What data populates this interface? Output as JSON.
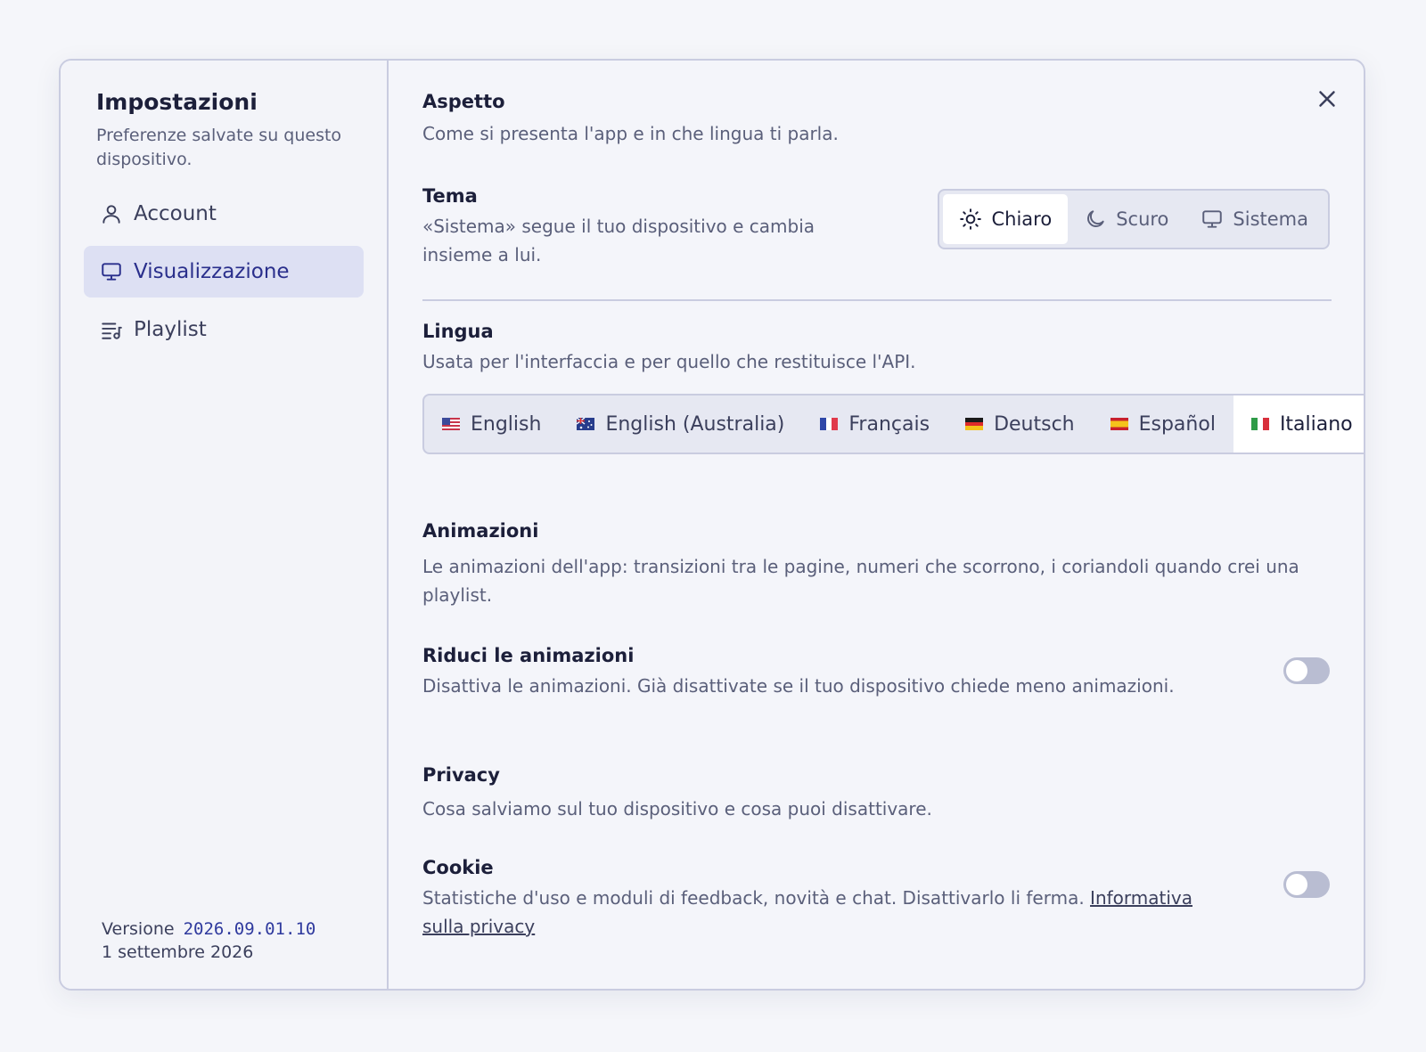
{
  "sidebar": {
    "title": "Impostazioni",
    "subtitle": "Preferenze salvate su questo dispositivo.",
    "items": [
      {
        "label": "Account",
        "icon": "user-icon"
      },
      {
        "label": "Visualizzazione",
        "icon": "monitor-icon",
        "active": true
      },
      {
        "label": "Playlist",
        "icon": "playlist-icon"
      }
    ],
    "version_label": "Versione",
    "version_code": "2026.09.01.10",
    "version_date": "1 settembre 2026"
  },
  "appearance": {
    "title": "Aspetto",
    "description": "Come si presenta l'app e in che lingua ti parla."
  },
  "theme": {
    "title": "Tema",
    "description": "«Sistema» segue il tuo dispositivo e cambia insieme a lui.",
    "options": [
      {
        "label": "Chiaro",
        "icon": "sun-icon",
        "selected": true
      },
      {
        "label": "Scuro",
        "icon": "moon-icon"
      },
      {
        "label": "Sistema",
        "icon": "monitor-icon"
      }
    ]
  },
  "language": {
    "title": "Lingua",
    "description": "Usata per l'interfaccia e per quello che restituisce l'API.",
    "options": [
      {
        "label": "English",
        "flag": "us-flag"
      },
      {
        "label": "English (Australia)",
        "flag": "au-flag"
      },
      {
        "label": "Français",
        "flag": "fr-flag"
      },
      {
        "label": "Deutsch",
        "flag": "de-flag"
      },
      {
        "label": "Español",
        "flag": "es-flag"
      },
      {
        "label": "Italiano",
        "flag": "it-flag",
        "selected": true
      }
    ]
  },
  "animations": {
    "title": "Animazioni",
    "description": "Le animazioni dell'app: transizioni tra le pagine, numeri che scorrono, i coriandoli quando crei una playlist.",
    "reduce_title": "Riduci le animazioni",
    "reduce_description": "Disattiva le animazioni. Già disattivate se il tuo dispositivo chiede meno animazioni.",
    "reduce_enabled": false
  },
  "privacy": {
    "title": "Privacy",
    "description": "Cosa salviamo sul tuo dispositivo e cosa puoi disattivare.",
    "cookie_title": "Cookie",
    "cookie_description": "Statistiche d'uso e moduli di feedback, novità e chat. Disattivarlo li ferma.",
    "cookie_link": "Informativa sulla privacy",
    "cookie_enabled": false
  },
  "colors": {
    "accent": "#2a2f8c",
    "active_nav_bg": "#dde0f3",
    "border": "#c9cce0",
    "toggle_off": "#b9bdd2"
  }
}
